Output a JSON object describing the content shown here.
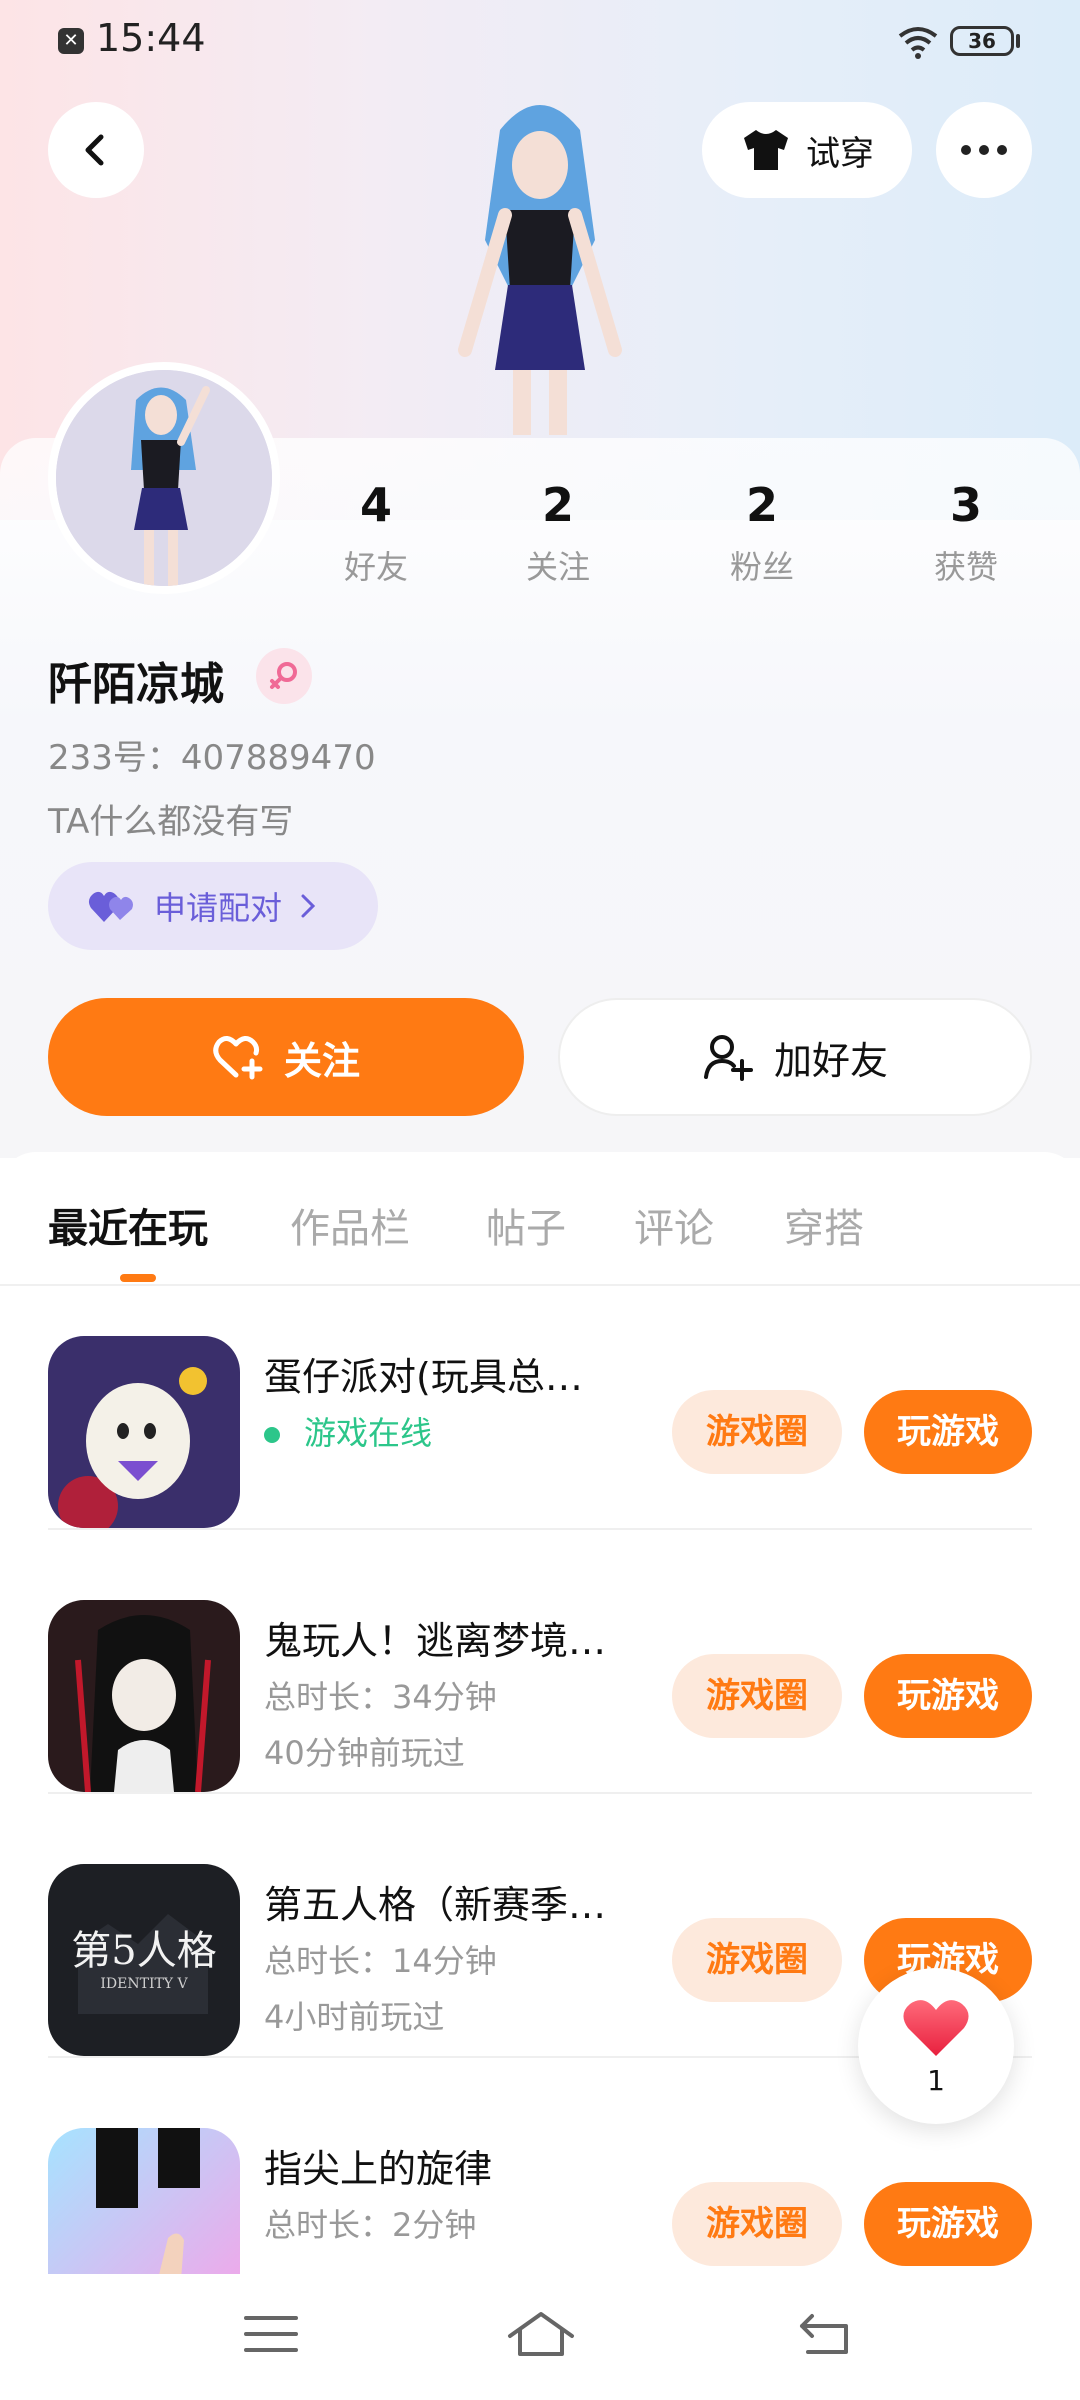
{
  "status_bar": {
    "time": "15:44",
    "battery": "36"
  },
  "header": {
    "tryon_label": "试穿"
  },
  "stats": [
    {
      "value": "4",
      "label": "好友"
    },
    {
      "value": "2",
      "label": "关注"
    },
    {
      "value": "2",
      "label": "粉丝"
    },
    {
      "value": "3",
      "label": "获赞"
    }
  ],
  "profile": {
    "nickname": "阡陌凉城",
    "uid": "233号：407889470",
    "bio": "TA什么都没有写",
    "pair_label": "申请配对"
  },
  "actions": {
    "follow_label": "关注",
    "add_friend_label": "加好友"
  },
  "tabs": [
    {
      "label": "最近在玩"
    },
    {
      "label": "作品栏"
    },
    {
      "label": "帖子"
    },
    {
      "label": "评论"
    },
    {
      "label": "穿搭"
    }
  ],
  "games": [
    {
      "title": "蛋仔派对(玩具总…",
      "line2": "游戏在线",
      "line3": "",
      "circle_label": "游戏圈",
      "play_label": "玩游戏"
    },
    {
      "title": "鬼玩人！逃离梦境…",
      "line2": "总时长：34分钟",
      "line3": "40分钟前玩过",
      "circle_label": "游戏圈",
      "play_label": "玩游戏"
    },
    {
      "title": "第五人格（新赛季…",
      "line2": "总时长：14分钟",
      "line3": "4小时前玩过",
      "circle_label": "游戏圈",
      "play_label": "玩游戏"
    },
    {
      "title": "指尖上的旋律",
      "line2": "总时长：2分钟",
      "line3": "",
      "circle_label": "游戏圈",
      "play_label": "玩游戏"
    }
  ],
  "game3_icon_text": "第5人格",
  "game3_icon_sub": "IDENTITY V",
  "like_fab": {
    "count": "1"
  },
  "colors": {
    "accent": "#ff7a13",
    "accent_light": "#fde9dc",
    "online": "#2cc68a",
    "pair": "#6a5ed9"
  }
}
